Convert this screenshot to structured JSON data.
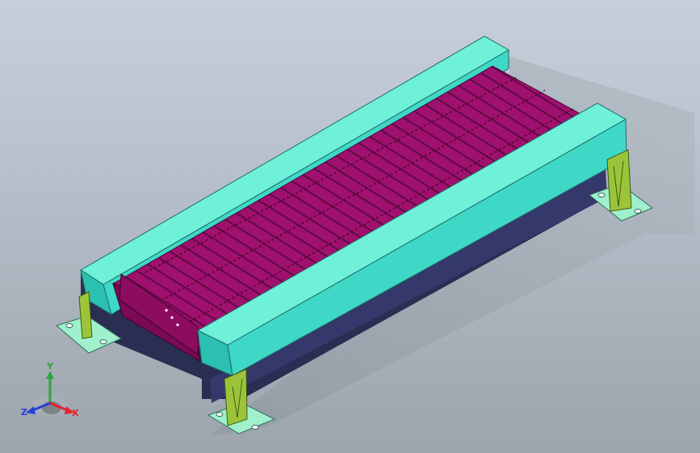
{
  "triad": {
    "x_label": "X",
    "y_label": "Y",
    "z_label": "Z",
    "x_color": "#e0242c",
    "y_color": "#2aa63a",
    "z_color": "#2540d8"
  },
  "colors": {
    "background_top": "#c7d0da",
    "background_bottom": "#9ca4ae",
    "rail_top": "#6ff0d8",
    "rail_side_light": "#3fd8c6",
    "rail_side_dark": "#2bc0b0",
    "chain_plates": "#a0106e",
    "frame_dark": "#2a2e52",
    "bracket_green": "#9cc43a",
    "foot_pad": "#9ff0cc"
  }
}
